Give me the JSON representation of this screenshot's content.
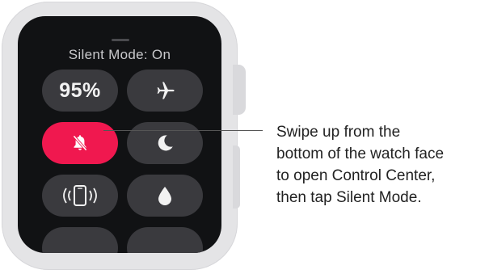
{
  "control_center": {
    "title": "Silent Mode: On",
    "battery_label": "95%",
    "tiles": [
      {
        "name": "battery-tile",
        "icon": "battery-percentage",
        "active": false
      },
      {
        "name": "airplane-mode-tile",
        "icon": "airplane-icon",
        "active": false
      },
      {
        "name": "silent-mode-tile",
        "icon": "bell-slash-icon",
        "active": true
      },
      {
        "name": "do-not-disturb-tile",
        "icon": "moon-icon",
        "active": false
      },
      {
        "name": "ping-iphone-tile",
        "icon": "phone-ping-icon",
        "active": false
      },
      {
        "name": "water-lock-tile",
        "icon": "water-drop-icon",
        "active": false
      }
    ]
  },
  "callout": {
    "lines": [
      "Swipe up from the",
      "bottom of the watch face",
      "to open Control Center,",
      "then tap Silent Mode."
    ]
  },
  "colors": {
    "accent_active": "#f0184f",
    "tile_inactive": "#3a3a3e",
    "screen_background": "#111214",
    "watch_case": "#e4e4e6"
  }
}
